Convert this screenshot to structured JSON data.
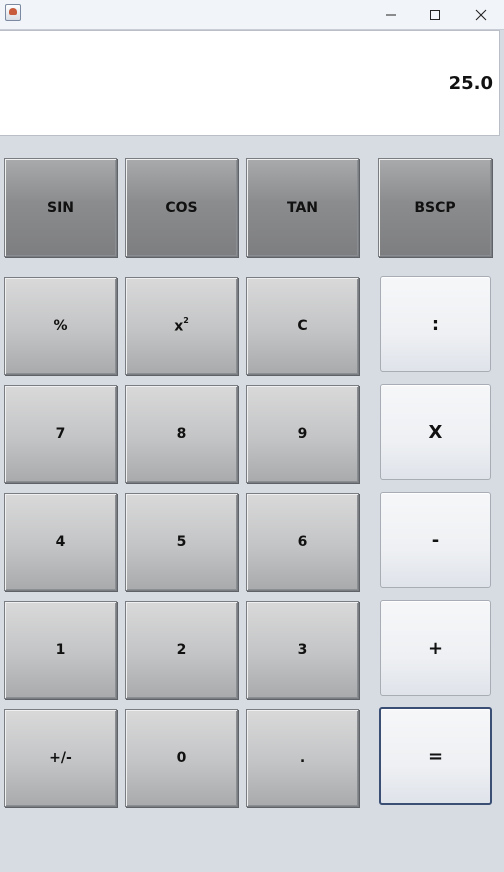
{
  "window": {
    "controls": [
      "minimize-icon",
      "maximize-icon",
      "close-icon"
    ]
  },
  "display": {
    "value": "25.0"
  },
  "buttons": {
    "sin": "SIN",
    "cos": "COS",
    "tan": "TAN",
    "bscp": "BSCP",
    "percent": "%",
    "square_base": "x",
    "square_exp": "2",
    "clear": "C",
    "divide": ":",
    "seven": "7",
    "eight": "8",
    "nine": "9",
    "multiply": "X",
    "four": "4",
    "five": "5",
    "six": "6",
    "minus": "-",
    "one": "1",
    "two": "2",
    "three": "3",
    "plus": "+",
    "negate": "+/-",
    "zero": "0",
    "dot": ".",
    "equals": "="
  }
}
